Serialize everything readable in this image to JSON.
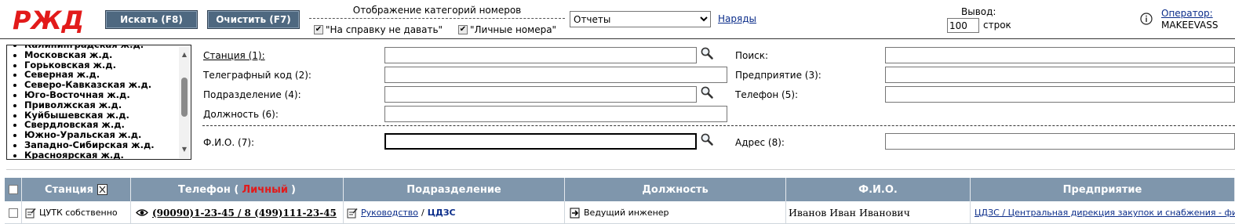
{
  "brand": {
    "logo_text": "РЖД",
    "color": "#e21a1a"
  },
  "toolbar": {
    "search_label": "Искать (F8)",
    "clear_label": "Очистить (F7)"
  },
  "categories": {
    "title": "Отображение категорий номеров",
    "no_reference": {
      "label": "\"На справку не давать\"",
      "checked": true
    },
    "personal": {
      "label": "\"Личные номера\"",
      "checked": true
    }
  },
  "report_select": {
    "selected": "Отчеты"
  },
  "orders_link": "Наряды",
  "output": {
    "label": "Вывод:",
    "value": "100",
    "unit": "строк"
  },
  "operator": {
    "label": "Оператор:",
    "name": "MAKEEVASS"
  },
  "regions": [
    "Калининградская ж.д.",
    "Московская ж.д.",
    "Горьковская ж.д.",
    "Северная ж.д.",
    "Северо-Кавказская ж.д.",
    "Юго-Восточная ж.д.",
    "Приволжская ж.д.",
    "Куйбышевская ж.д.",
    "Свердловская ж.д.",
    "Южно-Уральская ж.д.",
    "Западно-Сибирская ж.д.",
    "Красноярская ж.д."
  ],
  "form": {
    "station": {
      "label": "Станция (1):",
      "value": ""
    },
    "telegraph": {
      "label": "Телеграфный код (2):",
      "value": ""
    },
    "division": {
      "label": "Подразделение (4):",
      "value": ""
    },
    "position": {
      "label": "Должность (6):",
      "value": ""
    },
    "fio": {
      "label": "Ф.И.О. (7):",
      "value": ""
    },
    "search": {
      "label": "Поиск:",
      "value": ""
    },
    "enterprise": {
      "label": "Предприятие (3):",
      "value": ""
    },
    "phone": {
      "label": "Телефон (5):",
      "value": ""
    },
    "address": {
      "label": "Адрес (8):",
      "value": ""
    }
  },
  "table": {
    "headers": {
      "station": "Станция",
      "phone_prefix": "Телефон (",
      "phone_personal": "Личный",
      "phone_suffix": ")",
      "division": "Подразделение",
      "position": "Должность",
      "fio": "Ф.И.О.",
      "enterprise": "Предприятие"
    },
    "rows": [
      {
        "station": "ЦУТК собственно",
        "phone": "(90090)1-23-45 / 8 (499)111-23-45",
        "division_link": "Руководство",
        "division_sep": "/",
        "division_code": "ЦДЗС",
        "position": "Ведущий инженер",
        "fio": "Иванов Иван Иванович",
        "enterprise": "ЦДЗС / Центральная дирекция закупок и снабжения - фил"
      }
    ]
  }
}
